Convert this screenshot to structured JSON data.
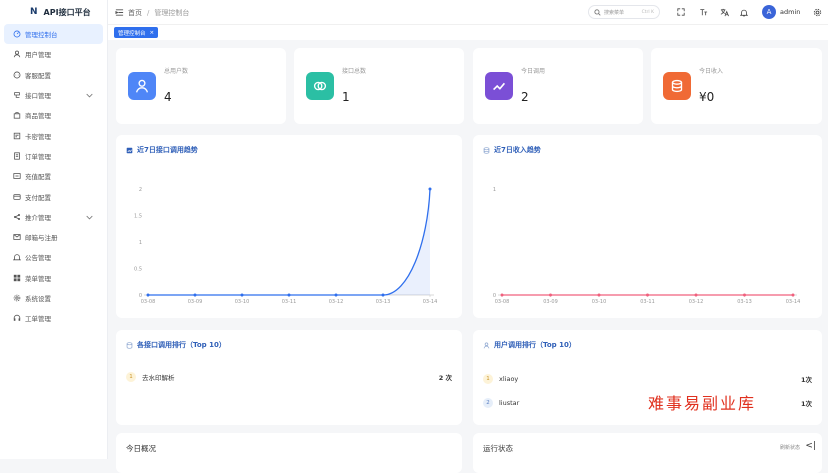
{
  "brand": {
    "logo": "N",
    "title": "API接口平台"
  },
  "sidebar": {
    "items": [
      {
        "label": "管理控制台",
        "icon": "dashboard-icon"
      },
      {
        "label": "用户管理",
        "icon": "user-icon"
      },
      {
        "label": "客服配置",
        "icon": "chat-icon"
      },
      {
        "label": "接口管理",
        "icon": "api-icon",
        "expandable": true
      },
      {
        "label": "商品管理",
        "icon": "bag-icon"
      },
      {
        "label": "卡密管理",
        "icon": "card-icon"
      },
      {
        "label": "订单管理",
        "icon": "order-icon"
      },
      {
        "label": "充值配置",
        "icon": "recharge-icon"
      },
      {
        "label": "支付配置",
        "icon": "payment-icon"
      },
      {
        "label": "推介管理",
        "icon": "share-icon",
        "expandable": true
      },
      {
        "label": "邮箱与注册",
        "icon": "mail-icon"
      },
      {
        "label": "公告管理",
        "icon": "bell-icon"
      },
      {
        "label": "菜单管理",
        "icon": "menu-grid-icon"
      },
      {
        "label": "系统设置",
        "icon": "gear-icon"
      },
      {
        "label": "工单管理",
        "icon": "headset-icon"
      }
    ]
  },
  "header": {
    "breadcrumb_home": "首页",
    "breadcrumb_sep": "/",
    "breadcrumb_current": "管理控制台",
    "search_placeholder": "搜索菜单",
    "search_shortcut": "Ctrl K",
    "avatar_letter": "A",
    "username": "admin"
  },
  "tabs": {
    "active_label": "管理控制台",
    "close": "×"
  },
  "stats": [
    {
      "label": "总用户数",
      "value": "4",
      "color": "#4f86f7"
    },
    {
      "label": "接口总数",
      "value": "1",
      "color": "#2bbfa4"
    },
    {
      "label": "今日调用",
      "value": "2",
      "color": "#7b4fd6"
    },
    {
      "label": "今日收入",
      "value": "¥0",
      "color": "#f06a35"
    }
  ],
  "api_trend": {
    "title": "近7日接口调用趋势",
    "chart_data": {
      "type": "area",
      "x": [
        "03-08",
        "03-09",
        "03-10",
        "03-11",
        "03-12",
        "03-13",
        "03-14"
      ],
      "values": [
        0,
        0,
        0,
        0,
        0,
        0,
        2
      ],
      "ylim": [
        0,
        2
      ],
      "yticks": [
        "0",
        "0.5",
        "1",
        "1.5",
        "2"
      ],
      "color": "#2f6fed"
    }
  },
  "income_trend": {
    "title": "近7日收入趋势",
    "chart_data": {
      "type": "line",
      "x": [
        "03-08",
        "03-09",
        "03-10",
        "03-11",
        "03-12",
        "03-13",
        "03-14"
      ],
      "values": [
        0,
        0,
        0,
        0,
        0,
        0,
        0
      ],
      "ylim": [
        0,
        1
      ],
      "yticks": [
        "0",
        "1"
      ],
      "color": "#f0607d"
    }
  },
  "api_rank": {
    "title": "各接口调用排行（Top 10）",
    "rows": [
      {
        "no": "1",
        "name": "去水印解析",
        "count": "2 次"
      }
    ]
  },
  "user_rank": {
    "title": "用户调用排行（Top 10）",
    "rows": [
      {
        "no": "1",
        "name": "xliaoy",
        "count": "1次"
      },
      {
        "no": "2",
        "name": "liustar",
        "count": "1次"
      }
    ]
  },
  "overview": {
    "title": "今日概况"
  },
  "runtime": {
    "title": "运行状态",
    "action": "刷新状态"
  },
  "watermark": "难事易副业库"
}
